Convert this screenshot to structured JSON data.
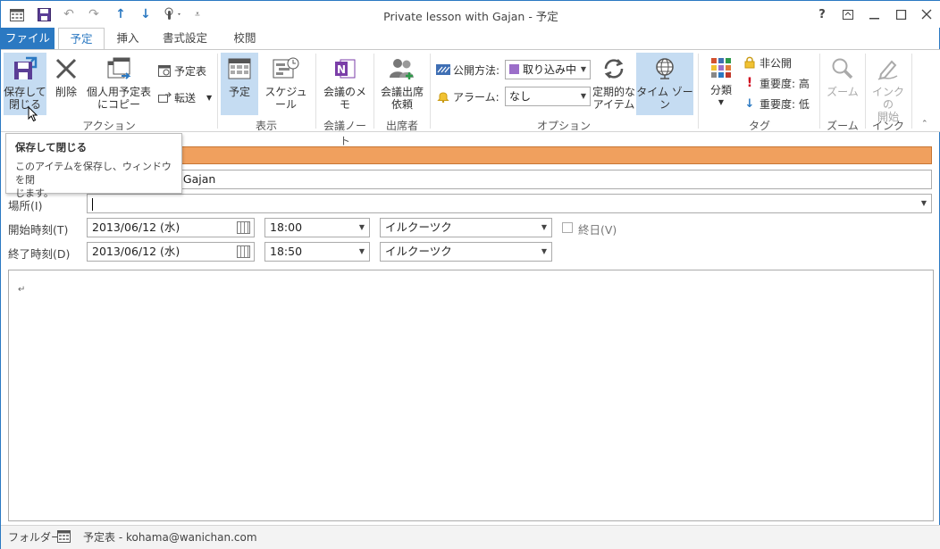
{
  "window": {
    "title": "Private lesson with Gajan - 予定",
    "help_label": "?"
  },
  "tabs": [
    {
      "label": "ファイル"
    },
    {
      "label": "予定"
    },
    {
      "label": "挿入"
    },
    {
      "label": "書式設定"
    },
    {
      "label": "校閲"
    }
  ],
  "ribbon": {
    "actions": {
      "save_close_line1": "保存して",
      "save_close_line2": "閉じる",
      "delete": "削除",
      "copy_line1": "個人用予定表",
      "copy_line2": "にコピー",
      "calendar": "予定表",
      "forward": "転送",
      "group": "アクション"
    },
    "show": {
      "appointment": "予定",
      "schedule": "スケジュール",
      "group": "表示"
    },
    "meeting_notes": {
      "label": "会議のメモ",
      "group": "会議ノート"
    },
    "attendees": {
      "label_line1": "会議出席",
      "label_line2": "依頼",
      "group": "出席者"
    },
    "options": {
      "show_as_label": "公開方法:",
      "show_as_value": "取り込み中",
      "reminder_label": "アラーム:",
      "reminder_value": "なし",
      "recurrence_line1": "定期的な",
      "recurrence_line2": "アイテム",
      "time_zone": "タイム ゾーン",
      "group": "オプション"
    },
    "tags": {
      "categorize": "分類",
      "private": "非公開",
      "high_importance": "重要度: 高",
      "low_importance": "重要度: 低",
      "group": "タグ"
    },
    "zoom": {
      "label": "ズーム",
      "group": "ズーム"
    },
    "ink": {
      "label_line1": "インクの",
      "label_line2": "開始",
      "group": "インク"
    }
  },
  "tooltip": {
    "title": "保存して閉じる",
    "desc_line1": "このアイテムを保存し、ウィンドウを閉",
    "desc_line2": "じます。"
  },
  "form": {
    "subject_value_visible": "h Gajan",
    "location_label": "場所(I)",
    "location_value": "",
    "start_label": "開始時刻(T)",
    "start_date": "2013/06/12 (水)",
    "start_time": "18:00",
    "start_tz": "イルクーツク",
    "all_day_label": "終日(V)",
    "end_label": "終了時刻(D)",
    "end_date": "2013/06/12 (水)",
    "end_time": "18:50",
    "end_tz": "イルクーツク",
    "body_mark": "↵"
  },
  "status": {
    "folder_label": "フォルダー",
    "folder_value": "予定表 - kohama@wanichan.com"
  },
  "colors": {
    "accent": "#2b79c2",
    "infobar": "#f0a05e",
    "selected": "#c5dcf2",
    "busy": "#9b6ec9"
  }
}
